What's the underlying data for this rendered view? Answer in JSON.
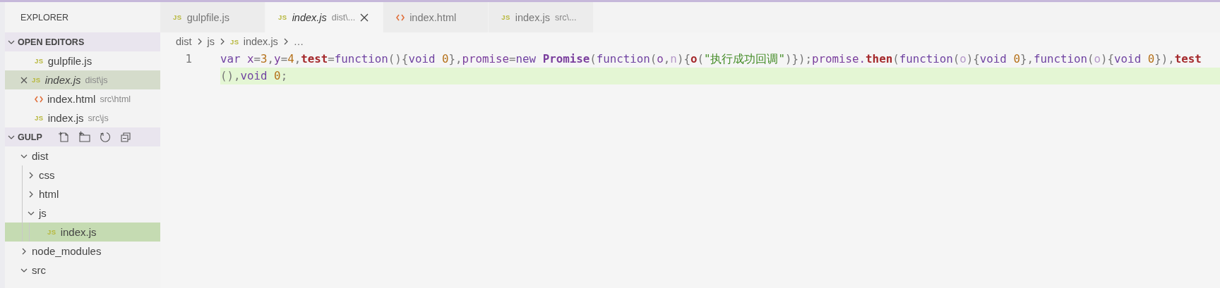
{
  "sidebar": {
    "title": "EXPLORER",
    "open_editors": {
      "label": "OPEN EDITORS",
      "expanded": true,
      "items": [
        {
          "name": "gulpfile.js",
          "kind": "js",
          "badge": "JS",
          "selected": false,
          "italic": false
        },
        {
          "name": "index.js",
          "description": "dist\\js",
          "kind": "js",
          "badge": "JS",
          "selected": true,
          "italic": true
        },
        {
          "name": "index.html",
          "description": "src\\html",
          "kind": "html",
          "selected": false,
          "italic": false
        },
        {
          "name": "index.js",
          "description": "src\\js",
          "kind": "js",
          "badge": "JS",
          "selected": false,
          "italic": false
        }
      ]
    },
    "folder": {
      "label": "GULP",
      "expanded": true,
      "tree": [
        {
          "name": "dist",
          "kind": "folder",
          "expanded": true,
          "selected": false,
          "children": [
            {
              "name": "css",
              "kind": "folder",
              "expanded": false,
              "selected": false
            },
            {
              "name": "html",
              "kind": "folder",
              "expanded": false,
              "selected": false
            },
            {
              "name": "js",
              "kind": "folder",
              "expanded": true,
              "selected": false,
              "children": [
                {
                  "name": "index.js",
                  "kind": "js",
                  "badge": "JS",
                  "selected": true
                }
              ]
            }
          ]
        },
        {
          "name": "node_modules",
          "kind": "folder",
          "expanded": false,
          "selected": false
        },
        {
          "name": "src",
          "kind": "folder",
          "expanded": true,
          "selected": false
        }
      ]
    }
  },
  "tabs": [
    {
      "label": "gulpfile.js",
      "kind": "js",
      "badge": "JS",
      "selected": false,
      "italic": false
    },
    {
      "label": "index.js",
      "description": "dist\\...",
      "kind": "js",
      "badge": "JS",
      "selected": true,
      "italic": true
    },
    {
      "label": "index.html",
      "kind": "html",
      "selected": false,
      "italic": false
    },
    {
      "label": "index.js",
      "description": "src\\...",
      "kind": "js",
      "badge": "JS",
      "selected": false,
      "italic": false
    }
  ],
  "breadcrumb": [
    {
      "label": "dist",
      "kind": "folder"
    },
    {
      "label": "js",
      "kind": "folder"
    },
    {
      "label": "index.js",
      "kind": "js",
      "badge": "JS"
    },
    {
      "label": "…",
      "kind": "more"
    }
  ],
  "editor": {
    "lines": [
      {
        "number": "1",
        "rows": [
          {
            "highlighted": false,
            "tokens": [
              {
                "t": "var ",
                "kind": "kw"
              },
              {
                "t": "x",
                "kind": "var"
              },
              {
                "t": "=",
                "kind": "op"
              },
              {
                "t": "3",
                "kind": "num"
              },
              {
                "t": ",",
                "kind": "op"
              },
              {
                "t": "y",
                "kind": "var"
              },
              {
                "t": "=",
                "kind": "op"
              },
              {
                "t": "4",
                "kind": "num"
              },
              {
                "t": ",",
                "kind": "op"
              },
              {
                "t": "test",
                "kind": "fn"
              },
              {
                "t": "=",
                "kind": "op"
              },
              {
                "t": "function",
                "kind": "kw"
              },
              {
                "t": "(){",
                "kind": "punct"
              },
              {
                "t": "void ",
                "kind": "kw"
              },
              {
                "t": "0",
                "kind": "num"
              },
              {
                "t": "},",
                "kind": "punct"
              },
              {
                "t": "promise",
                "kind": "var"
              },
              {
                "t": "=",
                "kind": "op"
              },
              {
                "t": "new ",
                "kind": "kw"
              },
              {
                "t": "Promise",
                "kind": "cls"
              },
              {
                "t": "(",
                "kind": "punct"
              },
              {
                "t": "function",
                "kind": "kw"
              },
              {
                "t": "(",
                "kind": "punct"
              },
              {
                "t": "o",
                "kind": "var"
              },
              {
                "t": ",",
                "kind": "op"
              },
              {
                "t": "n",
                "kind": "param"
              },
              {
                "t": "){",
                "kind": "punct"
              },
              {
                "t": "o",
                "kind": "fn"
              },
              {
                "t": "(",
                "kind": "punct"
              },
              {
                "t": "\"执行成功回调\"",
                "kind": "str"
              },
              {
                "t": ")});",
                "kind": "punct"
              },
              {
                "t": "promise.",
                "kind": "var"
              },
              {
                "t": "then",
                "kind": "fn"
              },
              {
                "t": "(",
                "kind": "punct"
              },
              {
                "t": "function",
                "kind": "kw"
              },
              {
                "t": "(",
                "kind": "punct"
              },
              {
                "t": "o",
                "kind": "param"
              },
              {
                "t": "){",
                "kind": "punct"
              },
              {
                "t": "void ",
                "kind": "kw"
              },
              {
                "t": "0",
                "kind": "num"
              },
              {
                "t": "},",
                "kind": "punct"
              },
              {
                "t": "function",
                "kind": "kw"
              },
              {
                "t": "(",
                "kind": "punct"
              },
              {
                "t": "o",
                "kind": "param"
              },
              {
                "t": "){",
                "kind": "punct"
              },
              {
                "t": "void ",
                "kind": "kw"
              },
              {
                "t": "0",
                "kind": "num"
              },
              {
                "t": "}),",
                "kind": "punct"
              },
              {
                "t": "test",
                "kind": "fn"
              }
            ]
          },
          {
            "highlighted": true,
            "tokens": [
              {
                "t": "(),",
                "kind": "punct"
              },
              {
                "t": "void ",
                "kind": "kw"
              },
              {
                "t": "0",
                "kind": "num"
              },
              {
                "t": ";",
                "kind": "punct"
              }
            ]
          }
        ]
      }
    ]
  }
}
